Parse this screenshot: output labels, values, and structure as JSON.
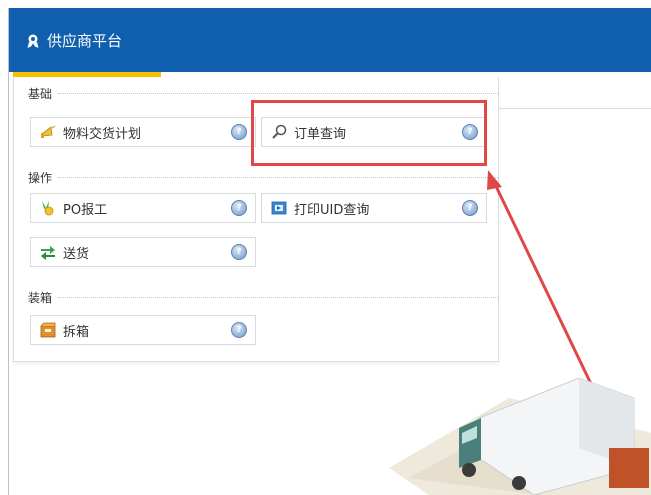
{
  "header": {
    "title": "供应商平台",
    "icon": "supplier-icon"
  },
  "sections": [
    {
      "label": "基础"
    },
    {
      "label": "操作"
    },
    {
      "label": "装箱"
    }
  ],
  "tiles": {
    "material_plan": {
      "label": "物料交货计划",
      "icon": "megaphone-icon"
    },
    "order_query": {
      "label": "订单查询",
      "icon": "magnifier-icon"
    },
    "po_report": {
      "label": "PO报工",
      "icon": "award-icon"
    },
    "print_uid": {
      "label": "打印UID查询",
      "icon": "print-icon"
    },
    "delivery": {
      "label": "送货",
      "icon": "transfer-icon"
    },
    "unbox": {
      "label": "拆箱",
      "icon": "box-icon"
    }
  },
  "help_glyph": "?",
  "colors": {
    "header_bg": "#0f5fae",
    "accent": "#f5c000",
    "highlight": "#e04848",
    "arrow": "#e04848"
  }
}
